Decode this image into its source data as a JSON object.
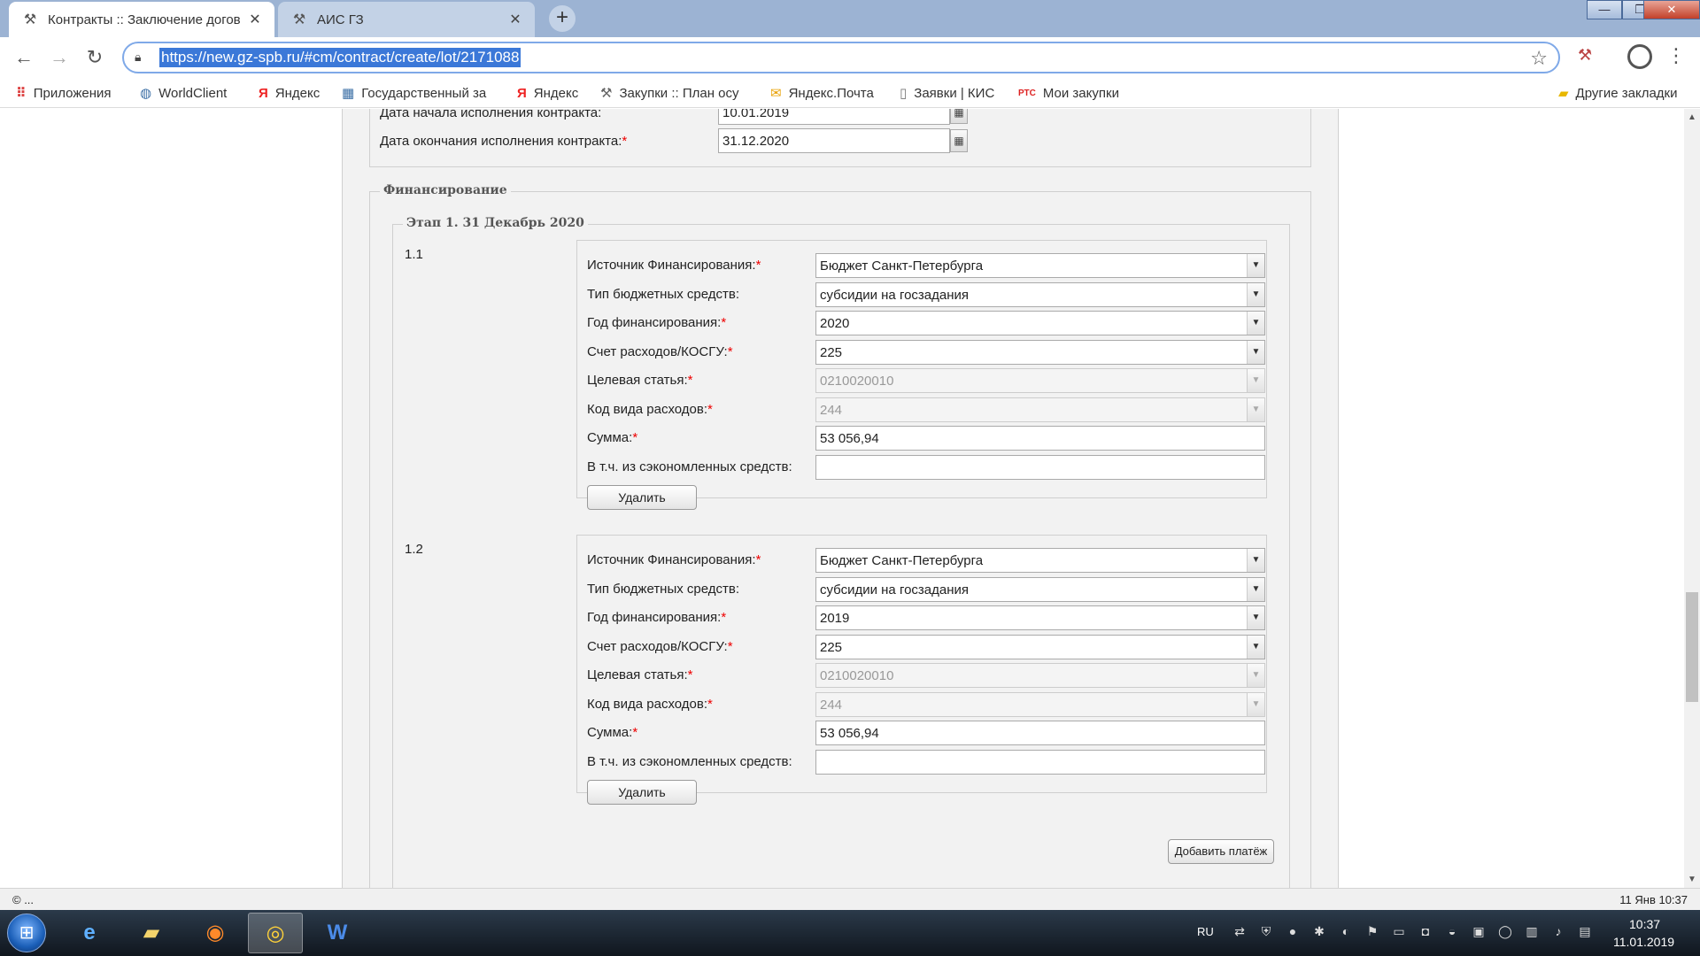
{
  "browser": {
    "tabs": [
      {
        "title": "Контракты :: Заключение догов",
        "icon": "wrench-icon",
        "active": true
      },
      {
        "title": "АИС ГЗ",
        "icon": "wrench-icon",
        "active": false
      }
    ],
    "new_tab": "+",
    "url": "https://new.gz-spb.ru/#cm/contract/create/lot/2171088",
    "window_controls": {
      "minimize": "—",
      "maximize": "❐",
      "close": "✕"
    }
  },
  "bookmarks": [
    {
      "label": "Приложения",
      "icon": "apps-grid-icon"
    },
    {
      "label": "WorldClient",
      "icon": "globe-icon"
    },
    {
      "label": "Яндекс",
      "icon": "yandex-icon"
    },
    {
      "label": "Государственный за",
      "icon": "building-icon"
    },
    {
      "label": "Яндекс",
      "icon": "yandex-icon"
    },
    {
      "label": "Закупки :: План осу",
      "icon": "wrench-icon"
    },
    {
      "label": "Яндекс.Почта",
      "icon": "mail-icon"
    },
    {
      "label": "Заявки | КИС",
      "icon": "page-icon"
    },
    {
      "label": "Мои закупки",
      "icon": "rts-icon",
      "icon_text": "РТС"
    }
  ],
  "other_bookmarks": "Другие закладки",
  "contract": {
    "start_date_label": "Дата начала исполнения контракта:",
    "start_date": "10.01.2019",
    "end_date_label": "Дата окончания исполнения контракта:",
    "end_date": "31.12.2020"
  },
  "financing": {
    "legend": "Финансирование",
    "stage_legend": "Этап 1. 31 Декабрь 2020",
    "labels": {
      "source": "Источник Финансирования:",
      "budget_type": "Тип бюджетных средств:",
      "year": "Год финансирования:",
      "kosgu": "Счет расходов/КОСГУ:",
      "target": "Целевая статья:",
      "expense_code": "Код вида расходов:",
      "amount": "Сумма:",
      "savings": "В т.ч. из сэкономленных средств:"
    },
    "required_mark": "*",
    "delete_label": "Удалить",
    "add_payment_label": "Добавить платёж",
    "items": [
      {
        "number": "1.1",
        "source": "Бюджет Санкт-Петербурга",
        "budget_type": "субсидии на госзадания",
        "year": "2020",
        "kosgu": "225",
        "target": "0210020010",
        "expense_code": "244",
        "amount": "53 056,94",
        "savings": ""
      },
      {
        "number": "1.2",
        "source": "Бюджет Санкт-Петербурга",
        "budget_type": "субсидии на госзадания",
        "year": "2019",
        "kosgu": "225",
        "target": "0210020010",
        "expense_code": "244",
        "amount": "53 056,94",
        "savings": ""
      }
    ]
  },
  "statusbar": {
    "left": "© ...",
    "right": "11 Янв 10:37"
  },
  "taskbar": {
    "apps": [
      "ie-icon",
      "explorer-icon",
      "firefox-icon",
      "chrome-icon",
      "word-icon"
    ],
    "lang": "RU",
    "time": "10:37",
    "date": "11.01.2019"
  }
}
